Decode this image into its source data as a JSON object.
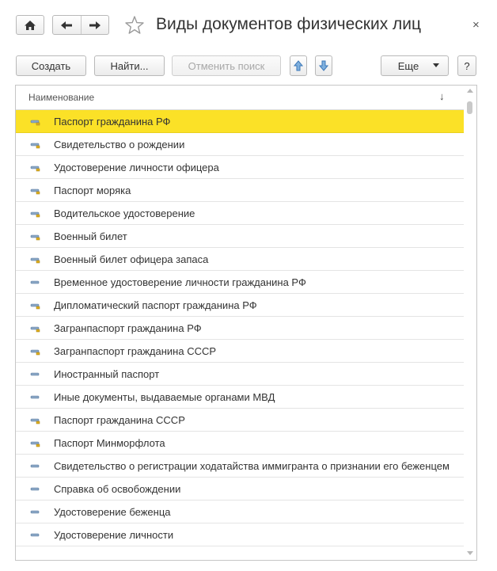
{
  "window": {
    "title": "Виды документов физических лиц",
    "close_symbol": "×",
    "icons": {
      "home": "home-icon",
      "back": "arrow-left-icon",
      "forward": "arrow-right-icon",
      "favorite": "star-icon"
    }
  },
  "toolbar": {
    "create_label": "Создать",
    "find_label": "Найти...",
    "cancel_search_label": "Отменить поиск",
    "more_label": "Еще",
    "help_label": "?",
    "icons": {
      "move_up": "arrow-up-icon",
      "move_down": "arrow-down-icon"
    }
  },
  "table": {
    "column_header": "Наименование",
    "sort_indicator": "↓",
    "selected_color": "#fbe127",
    "rows": [
      {
        "label": "Паспорт гражданина РФ",
        "icon": "predefined-item-icon",
        "selected": true
      },
      {
        "label": "Свидетельство о рождении",
        "icon": "predefined-item-icon"
      },
      {
        "label": "Удостоверение личности офицера",
        "icon": "predefined-item-icon"
      },
      {
        "label": "Паспорт моряка",
        "icon": "predefined-item-icon"
      },
      {
        "label": "Водительское удостоверение",
        "icon": "predefined-item-icon"
      },
      {
        "label": "Военный билет",
        "icon": "predefined-item-icon"
      },
      {
        "label": "Военный билет офицера запаса",
        "icon": "predefined-item-icon"
      },
      {
        "label": "Временное удостоверение личности гражданина РФ",
        "icon": "item-icon"
      },
      {
        "label": "Дипломатический паспорт гражданина РФ",
        "icon": "predefined-item-icon"
      },
      {
        "label": "Загранпаспорт гражданина РФ",
        "icon": "predefined-item-icon"
      },
      {
        "label": "Загранпаспорт гражданина СССР",
        "icon": "predefined-item-icon"
      },
      {
        "label": "Иностранный паспорт",
        "icon": "item-icon"
      },
      {
        "label": "Иные документы, выдаваемые органами МВД",
        "icon": "item-icon"
      },
      {
        "label": "Паспорт гражданина СССР",
        "icon": "predefined-item-icon"
      },
      {
        "label": "Паспорт Минморфлота",
        "icon": "predefined-item-icon"
      },
      {
        "label": "Свидетельство о регистрации ходатайства иммигранта о признании его беженцем",
        "icon": "item-icon"
      },
      {
        "label": "Справка об освобождении",
        "icon": "item-icon"
      },
      {
        "label": "Удостоверение беженца",
        "icon": "item-icon"
      },
      {
        "label": "Удостоверение личности",
        "icon": "item-icon"
      }
    ]
  }
}
